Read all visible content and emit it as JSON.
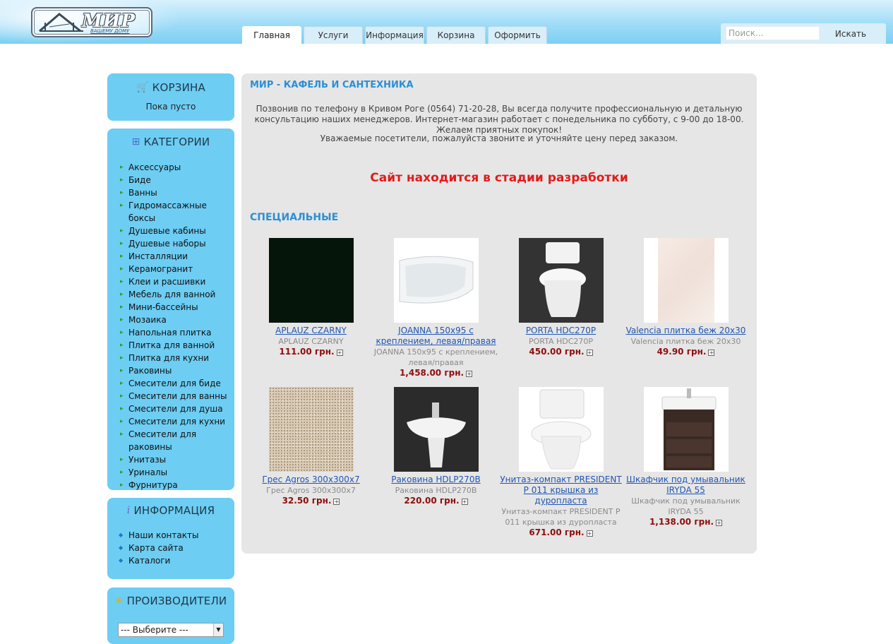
{
  "header": {
    "logo_text": "МИР",
    "logo_sub": "ВАШЕМУ ДОМУ",
    "tabs": [
      "Главная",
      "Услуги",
      "Информация",
      "Корзина",
      "Оформить"
    ],
    "search": {
      "placeholder": "Поиск...",
      "button": "Искать"
    }
  },
  "sidebar": {
    "cart": {
      "title": "КОРЗИНА",
      "empty": "Пока пусто"
    },
    "categories": {
      "title": "КАТЕГОРИИ",
      "items": [
        "Аксессуары",
        "Биде",
        "Ванны",
        "Гидромассажные боксы",
        "Душевые кабины",
        "Душевые наборы",
        "Инсталляции",
        "Керамогранит",
        "Клеи и расшивки",
        "Мебель для ванной",
        "Мини-бассейны",
        "Мозаика",
        "Напольная плитка",
        "Плитка для ванной",
        "Плитка для кухни",
        "Раковины",
        "Смесители для биде",
        "Смесители для ванны",
        "Смесители для душа",
        "Смесители для кухни",
        "Смесители для раковины",
        "Унитазы",
        "Уриналы",
        "Фурнитура"
      ]
    },
    "info": {
      "title": "ИНФОРМАЦИЯ",
      "items": [
        "Наши контакты",
        "Карта сайта",
        "Каталоги"
      ]
    },
    "manufacturers": {
      "title": "ПРОИЗВОДИТЕЛИ",
      "select_value": "--- Выберите ---"
    }
  },
  "main": {
    "title": "МИР - КАФЕЛЬ И САНТЕХНИКА",
    "intro": "Позвонив по телефону в Кривом Роге (0564) 71-20-28, Вы всегда получите профессиональную и детальную консультацию наших менеджеров. Интернет-магазин работает с понедельника по субботу, с 9-00 до 18-00. Желаем приятных покупок!",
    "intro2": "Уважаемые посетители, пожалуйста звоните и уточняйте цену перед заказом.",
    "dev_notice": "Сайт находится в стадии разработки",
    "specials_title": "СПЕЦИАЛЬНЫЕ",
    "products": [
      {
        "name": "APLAUZ CZARNY",
        "desc": "APLAUZ CZARNY",
        "price": "111.00 грн.",
        "image": "black-tile"
      },
      {
        "name": "JOANNA 150x95 с креплением, левая/правая",
        "desc": "JOANNA 150x95 с креплением, левая/правая",
        "price": "1,458.00 грн.",
        "image": "corner-bathtub"
      },
      {
        "name": "PORTA HDC270P",
        "desc": "PORTA HDC270P",
        "price": "450.00 грн.",
        "image": "toilet-dark"
      },
      {
        "name": "Valencia плитка беж 20x30",
        "desc": "Valencia плитка беж 20x30",
        "price": "49.90 грн.",
        "image": "beige-tile"
      },
      {
        "name": "Грес Agros 300x300x7",
        "desc": "Грес Agros 300x300x7",
        "price": "32.50 грн.",
        "image": "speckled-tile"
      },
      {
        "name": "Раковина HDLP270B",
        "desc": "Раковина HDLP270B",
        "price": "220.00 грн.",
        "image": "pedestal-sink"
      },
      {
        "name": "Унитаз-компакт PRESIDENT P 011 крышка из дуропласта",
        "desc": "Унитаз-компакт PRESIDENT P 011 крышка из дуропласта",
        "price": "671.00 грн.",
        "image": "toilet-white"
      },
      {
        "name": "Шкафчик под умывальник IRYDA 55",
        "desc": "Шкафчик под умывальник IRYDA 55",
        "price": "1,138.00 грн.",
        "image": "vanity-cabinet"
      }
    ]
  }
}
